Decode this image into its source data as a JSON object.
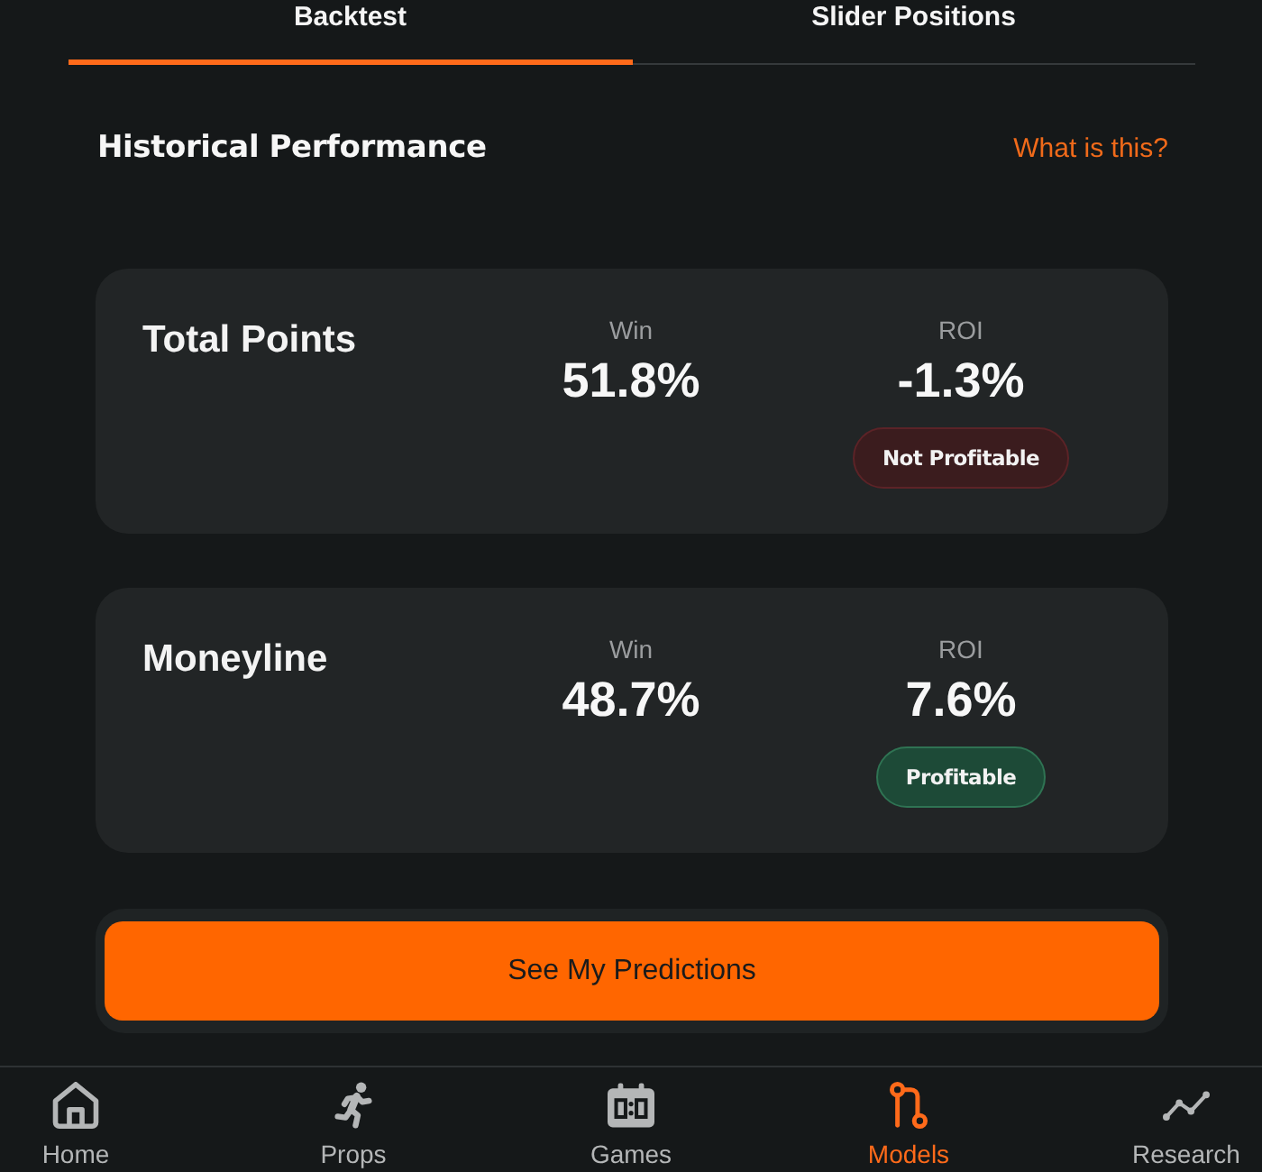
{
  "tabs": [
    {
      "label": "Backtest",
      "selected": true
    },
    {
      "label": "Slider Positions",
      "selected": false
    }
  ],
  "section": {
    "title": "Historical Performance",
    "link": "What is this?"
  },
  "cards": [
    {
      "title": "Total Points",
      "stats": [
        {
          "label": "Win",
          "value": "51.8%"
        },
        {
          "label": "ROI",
          "value": "-1.3%"
        }
      ],
      "badge": {
        "label": "Not Profitable",
        "profitable": false
      }
    },
    {
      "title": "Moneyline",
      "stats": [
        {
          "label": "Win",
          "value": "48.7%"
        },
        {
          "label": "ROI",
          "value": "7.6%"
        }
      ],
      "badge": {
        "label": "Profitable",
        "profitable": true
      }
    }
  ],
  "action_button": {
    "label": "See My Predictions"
  },
  "bottom_nav": [
    {
      "label": "Home",
      "selected": false
    },
    {
      "label": "Props",
      "selected": false
    },
    {
      "label": "Games",
      "selected": false
    },
    {
      "label": "Models",
      "selected": true
    },
    {
      "label": "Research",
      "selected": false
    }
  ]
}
